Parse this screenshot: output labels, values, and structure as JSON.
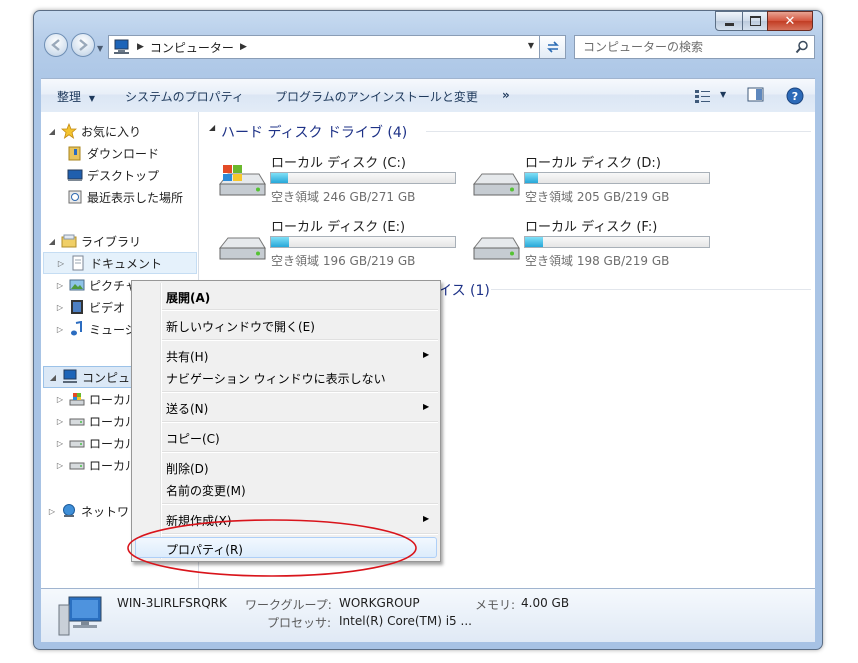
{
  "window": {
    "controls": {
      "minimize": "—",
      "maximize": "□",
      "close": "✕"
    }
  },
  "address": {
    "path": [
      "コンピューター"
    ],
    "search_placeholder": "コンピューターの検索"
  },
  "toolbar": {
    "organize": "整理",
    "system_properties": "システムのプロパティ",
    "uninstall": "プログラムのアンインストールと変更",
    "more": "»"
  },
  "nav": {
    "favorites": "お気に入り",
    "downloads": "ダウンロード",
    "desktop": "デスクトップ",
    "recent": "最近表示した場所",
    "libraries": "ライブラリ",
    "documents": "ドキュメント",
    "pictures": "ピクチャ",
    "videos": "ビデオ",
    "music": "ミュージ",
    "computer": "コンピュー",
    "local_c": "ローカル",
    "local_d": "ローカル",
    "local_e": "ローカル",
    "local_f": "ローカル",
    "network": "ネットワ"
  },
  "main": {
    "hdd_group": "ハード ディスク ドライブ (4)",
    "removable_group_partial": "イス (1)",
    "drives": [
      {
        "name": "ローカル ディスク (C:)",
        "free": "空き領域 246 GB/271 GB",
        "used_fraction": 0.09
      },
      {
        "name": "ローカル ディスク (D:)",
        "free": "空き領域 205 GB/219 GB",
        "used_fraction": 0.07
      },
      {
        "name": "ローカル ディスク (E:)",
        "free": "空き領域 196 GB/219 GB",
        "used_fraction": 0.1
      },
      {
        "name": "ローカル ディスク (F:)",
        "free": "空き領域 198 GB/219 GB",
        "used_fraction": 0.1
      }
    ]
  },
  "context_menu": {
    "expand": "展開(A)",
    "open_new_window": "新しいウィンドウで開く(E)",
    "share": "共有(H)",
    "hide_nav": "ナビゲーション ウィンドウに表示しない",
    "send_to": "送る(N)",
    "copy": "コピー(C)",
    "delete": "削除(D)",
    "rename": "名前の変更(M)",
    "new": "新規作成(X)",
    "properties": "プロパティ(R)"
  },
  "details": {
    "computer_name": "WIN-3LIRLFSRQRK",
    "workgroup_label": "ワークグループ:",
    "workgroup": "WORKGROUP",
    "memory_label": "メモリ:",
    "memory": "4.00 GB",
    "processor_label": "プロセッサ:",
    "processor": "Intel(R) Core(TM) i5 ..."
  },
  "colors": {
    "accent": "#1e395b",
    "group_header": "#1e3287",
    "drive_fill": "#27a7d8",
    "highlight_ellipse": "#d9141b"
  }
}
